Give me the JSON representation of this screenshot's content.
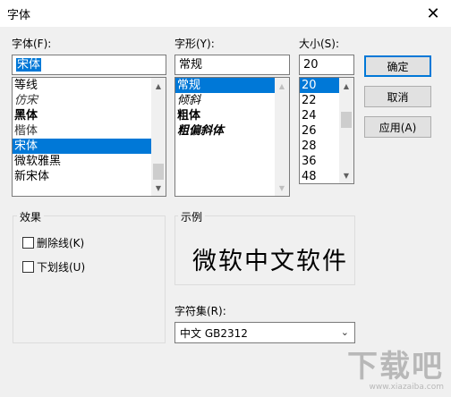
{
  "window": {
    "title": "字体",
    "close_glyph": "✕"
  },
  "font": {
    "label": "字体(F):",
    "value": "宋体",
    "items": [
      "等线",
      "仿宋",
      "黑体",
      "楷体",
      "宋体",
      "微软雅黑",
      "新宋体"
    ],
    "selected_index": 4
  },
  "style": {
    "label": "字形(Y):",
    "value": "常规",
    "items": [
      "常规",
      "倾斜",
      "粗体",
      "粗偏斜体"
    ],
    "selected_index": 0
  },
  "size": {
    "label": "大小(S):",
    "value": "20",
    "items": [
      "20",
      "22",
      "24",
      "26",
      "28",
      "36",
      "48"
    ],
    "selected_index": 0
  },
  "buttons": {
    "ok": "确定",
    "cancel": "取消",
    "apply": "应用(A)"
  },
  "effects": {
    "title": "效果",
    "strikeout": "删除线(K)",
    "underline": "下划线(U)",
    "strikeout_checked": false,
    "underline_checked": false
  },
  "sample": {
    "title": "示例",
    "text": "微软中文软件"
  },
  "charset": {
    "label": "字符集(R):",
    "value": "中文 GB2312"
  },
  "watermark": {
    "text": "下载吧",
    "url": "www.xiazaiba.com"
  },
  "colors": {
    "accent": "#0078d7"
  }
}
